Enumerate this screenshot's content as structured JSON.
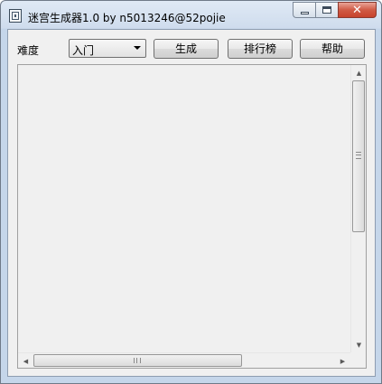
{
  "window": {
    "title": "迷宫生成器1.0 by n5013246@52pojie",
    "icon": "maze-app-icon",
    "caption_buttons": [
      "minimize",
      "maximize",
      "close"
    ]
  },
  "toolbar": {
    "difficulty_label": "难度",
    "difficulty_value": "入门",
    "generate_label": "生成",
    "leaderboard_label": "排行榜",
    "help_label": "帮助"
  },
  "scrollbars": {
    "vertical": {
      "up_arrow": "▲",
      "down_arrow": "▼"
    },
    "horizontal": {
      "left_arrow": "◀",
      "right_arrow": "▶"
    }
  },
  "colors": {
    "client_bg": "#f0f0f0",
    "close_button": "#c7432c",
    "frame": "#c5d6ea"
  }
}
